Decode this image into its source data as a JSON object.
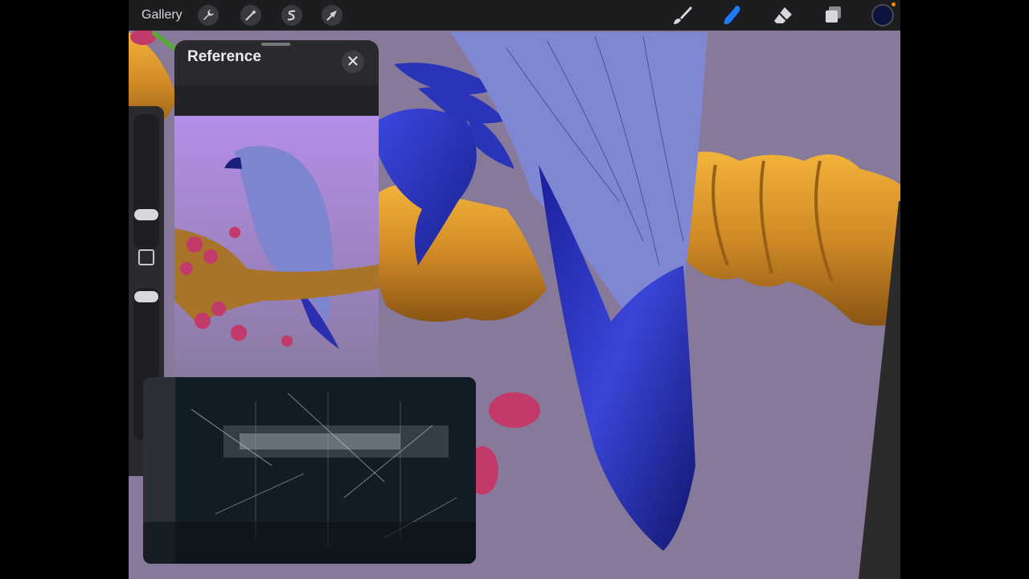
{
  "toolbar": {
    "gallery_label": "Gallery",
    "actions_icon": "wrench-icon",
    "adjustments_icon": "magic-wand-icon",
    "selection_icon": "selection-s-icon",
    "transform_icon": "arrow-cursor-icon",
    "brush_icon": "brush-icon",
    "smudge_icon": "smudge-finger-icon",
    "eraser_icon": "eraser-icon",
    "layers_icon": "layers-icon",
    "active_color": "#0b1440",
    "active_tool_color": "#1a7bff"
  },
  "reference": {
    "title": "Reference",
    "close_symbol": "✕"
  },
  "colors": {
    "canvas_background": "#86799a",
    "branch": "#d6902a",
    "bird_body": "#8087d2",
    "bird_tail": "#2a2fb0",
    "flower": "#c23a6a"
  }
}
